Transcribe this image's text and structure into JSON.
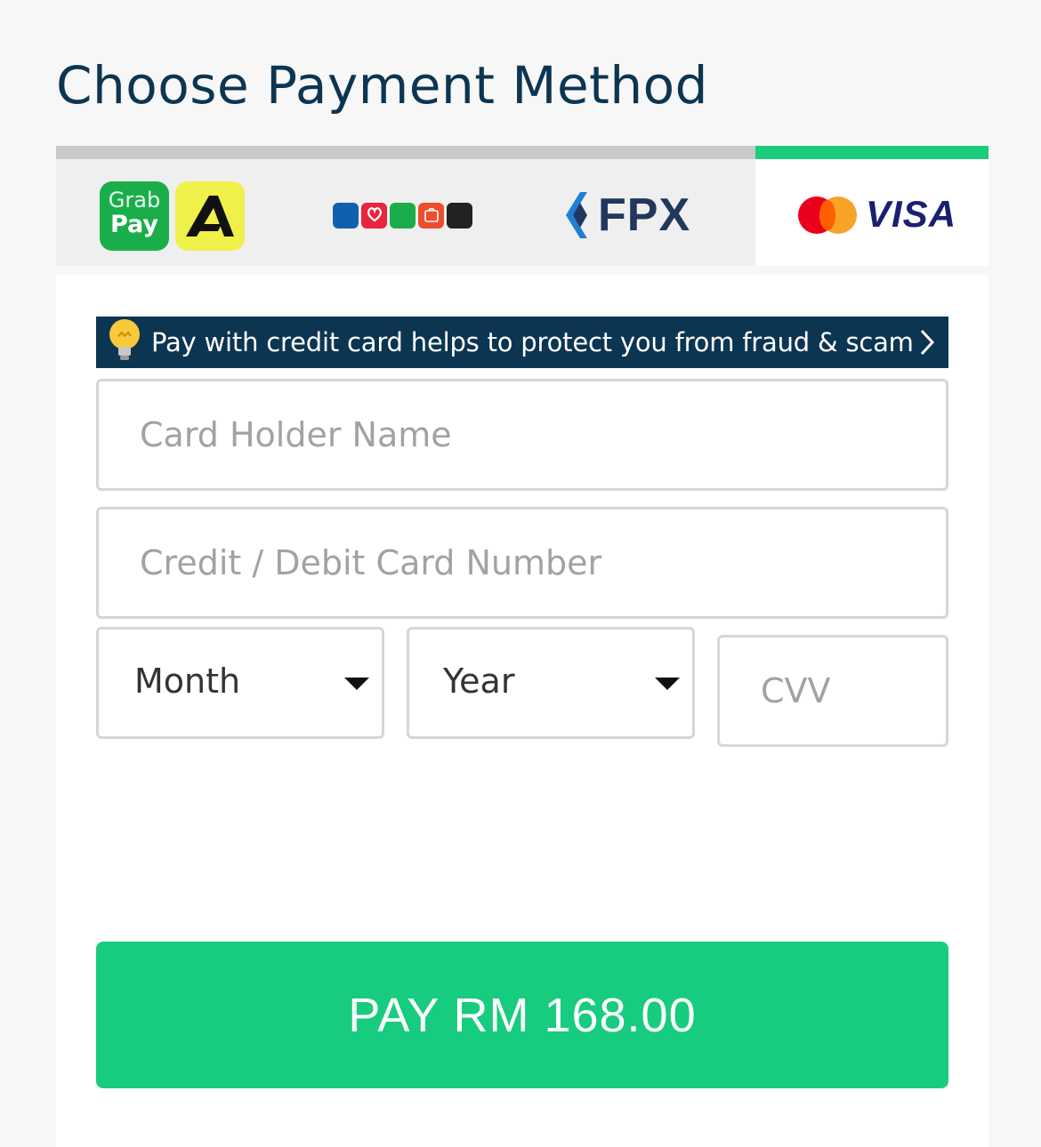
{
  "header": {
    "title": "Choose Payment Method"
  },
  "tabs": [
    {
      "name": "GrabPay / Atome",
      "logos": [
        "Grab",
        "Pay"
      ],
      "active": false
    },
    {
      "name": "E-Wallets",
      "logos": [
        "Touch 'n Go eWallet",
        "Boost",
        "Grab Pay",
        "ShopeePay",
        "ShopBack"
      ],
      "active": false
    },
    {
      "name": "FPX",
      "logo_text": "FPX",
      "active": false
    },
    {
      "name": "Card",
      "logo_text": "VISA",
      "active": true
    }
  ],
  "banner": {
    "text": "Pay with credit card helps to protect you from fraud & scam"
  },
  "form": {
    "card_holder_placeholder": "Card Holder Name",
    "card_number_placeholder": "Credit / Debit Card Number",
    "month_label": "Month",
    "year_label": "Year",
    "cvv_placeholder": "CVV"
  },
  "pay_button": {
    "label": "PAY RM 168.00"
  },
  "colors": {
    "brand_navy": "#0c3552",
    "accent_green": "#1ccd7f",
    "tab_inactive": "#c9c9c9"
  }
}
